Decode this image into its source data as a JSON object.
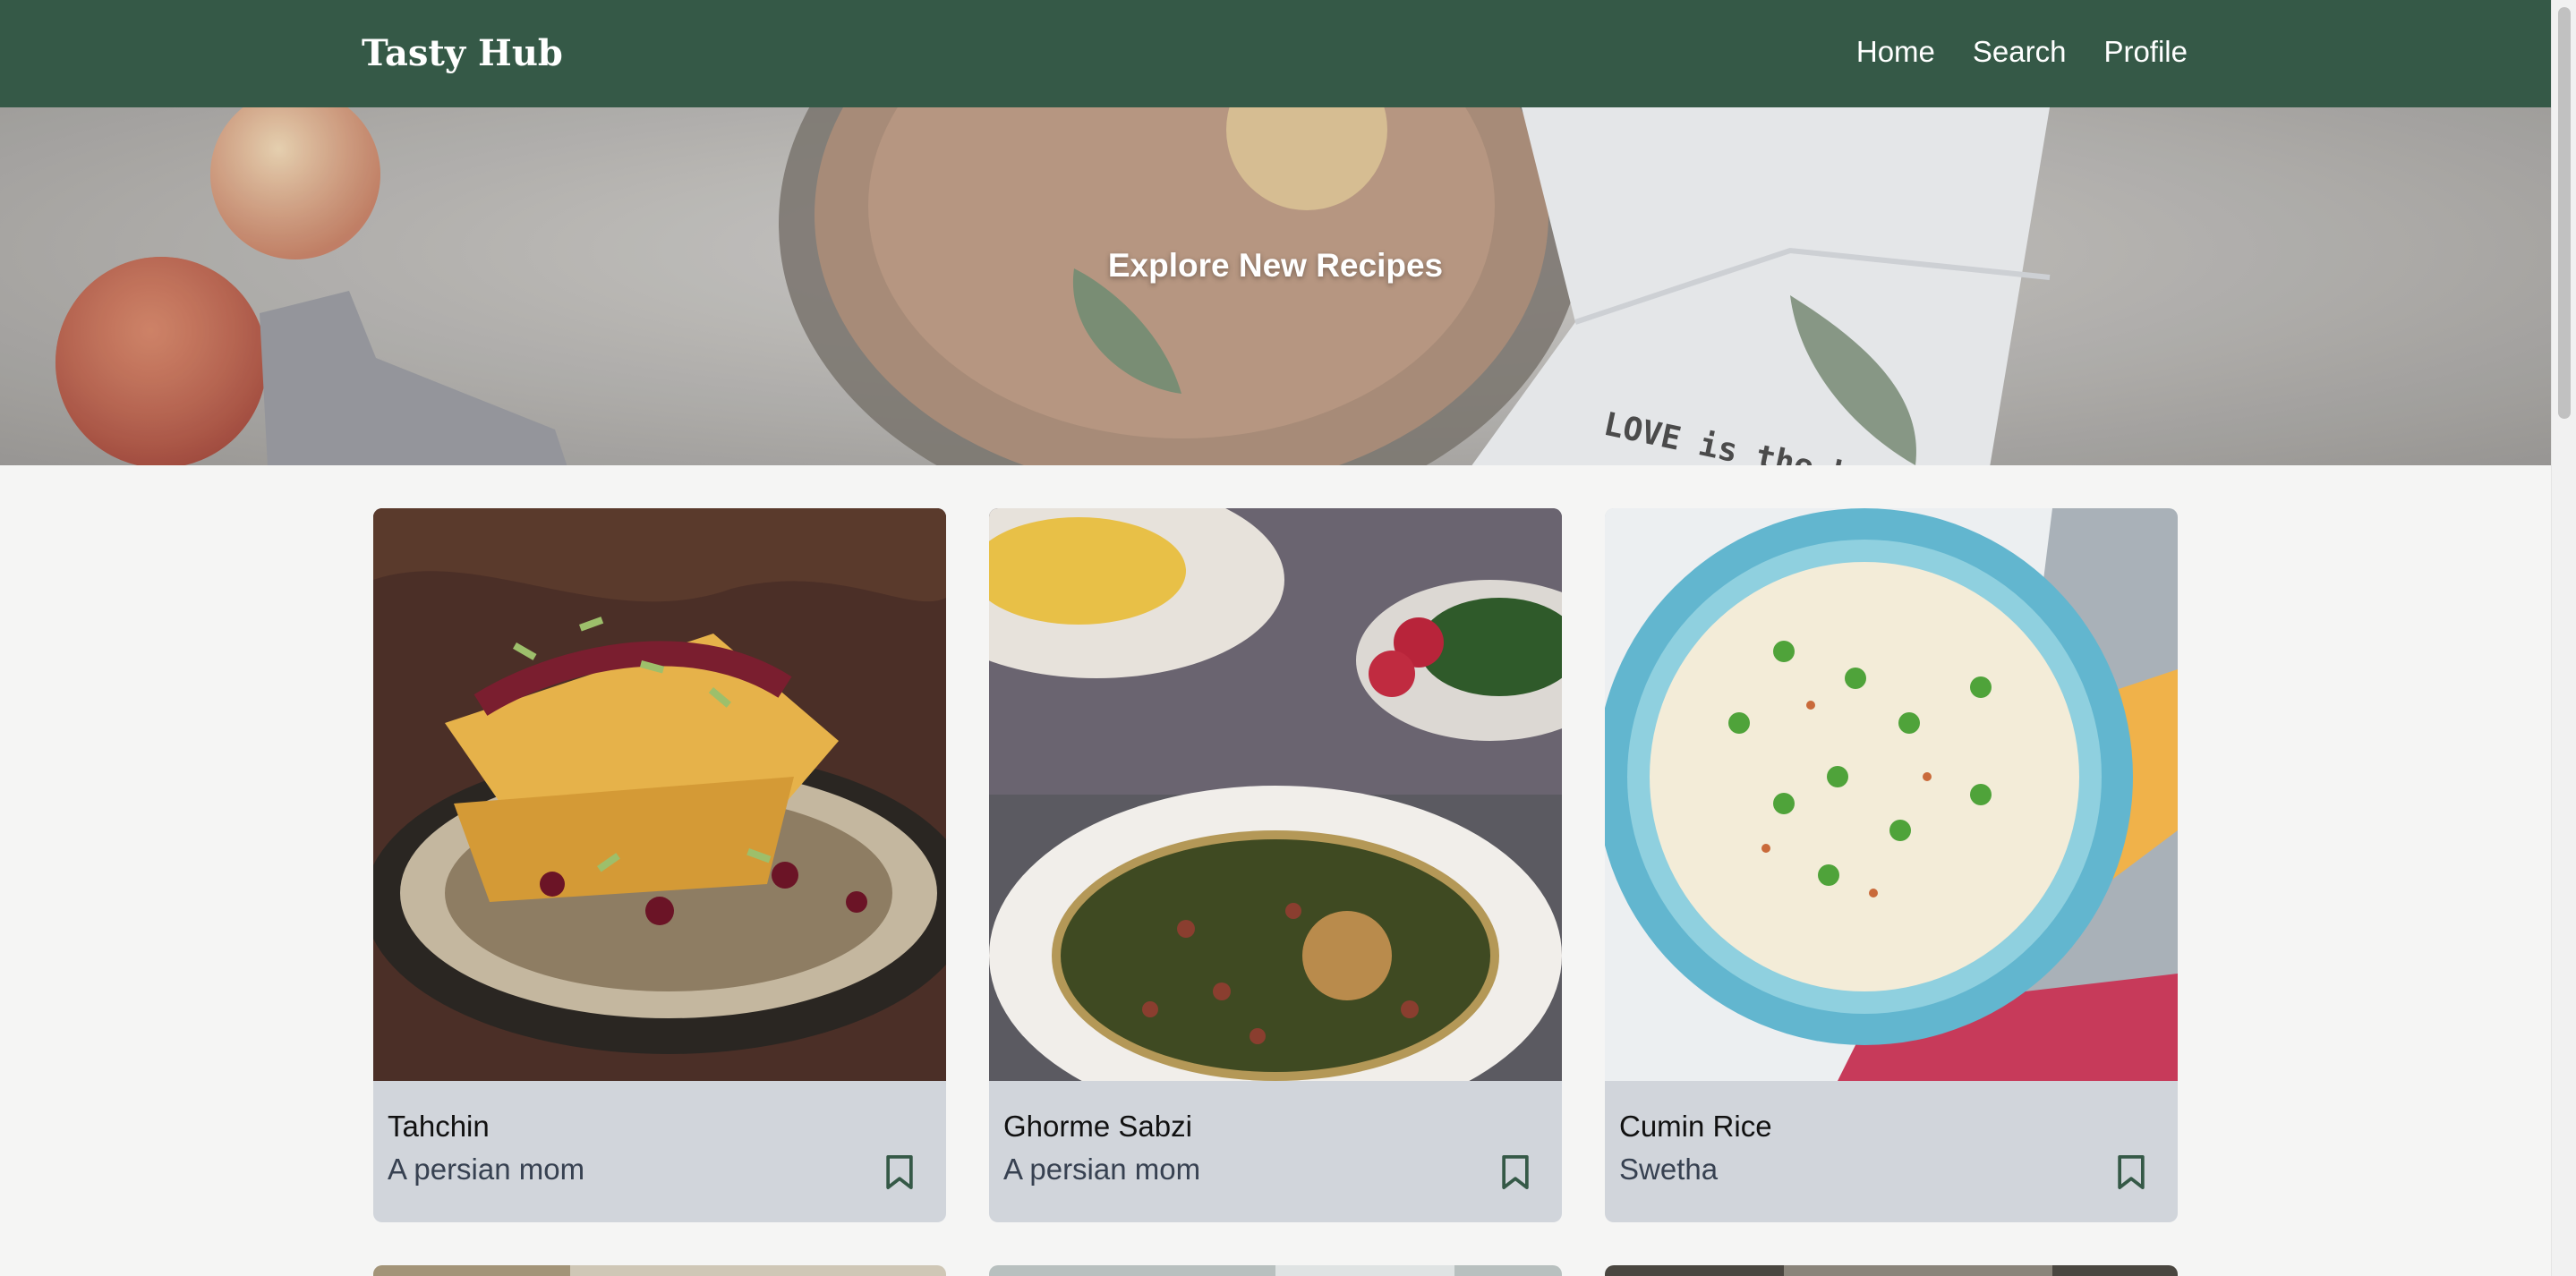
{
  "app": {
    "title": "Tasty Hub"
  },
  "nav": {
    "links": [
      "Home",
      "Search",
      "Profile"
    ]
  },
  "hero": {
    "title": "Explore New Recipes",
    "napkin_text": "LOVE is the best ingred"
  },
  "recipes": [
    {
      "title": "Tahchin",
      "author": "A persian mom"
    },
    {
      "title": "Ghorme Sabzi",
      "author": "A persian mom"
    },
    {
      "title": "Cumin Rice",
      "author": "Swetha"
    }
  ],
  "colors": {
    "nav_bg": "#355947",
    "card_bg": "#d1d5db",
    "page_bg": "#f5f5f4",
    "icon": "#355947"
  }
}
